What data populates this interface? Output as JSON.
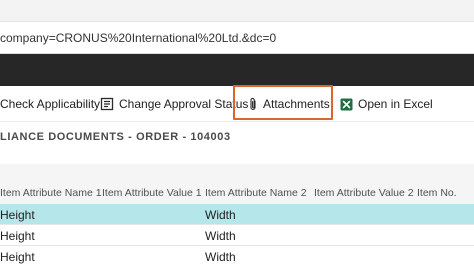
{
  "browser": {
    "url": "company=CRONUS%20International%20Ltd.&dc=0"
  },
  "actions": [
    {
      "label": "Check Applicability",
      "icon": "check-applicability-icon"
    },
    {
      "label": "Change Approval Status",
      "icon": "approval-status-icon"
    },
    {
      "label": "Attachments",
      "icon": "paperclip-icon"
    },
    {
      "label": "Open in Excel",
      "icon": "excel-icon"
    }
  ],
  "highlight_color": "#d9662f",
  "excel_green": "#1d6f42",
  "document": {
    "title": "LIANCE DOCUMENTS - ORDER - 104003"
  },
  "table": {
    "headers": [
      "Item Attribute Name 1",
      "Item Attribute Value 1",
      "Item Attribute Name 2",
      "Item Attribute Value 2",
      "Item No."
    ],
    "rows": [
      {
        "cells": [
          "Height",
          "",
          "Width",
          "",
          ""
        ],
        "selected": true
      },
      {
        "cells": [
          "Height",
          "",
          "Width",
          "",
          ""
        ],
        "selected": false
      },
      {
        "cells": [
          "Height",
          "",
          "Width",
          "",
          ""
        ],
        "selected": false
      }
    ],
    "selected_row_color": "#b4e6ea"
  }
}
